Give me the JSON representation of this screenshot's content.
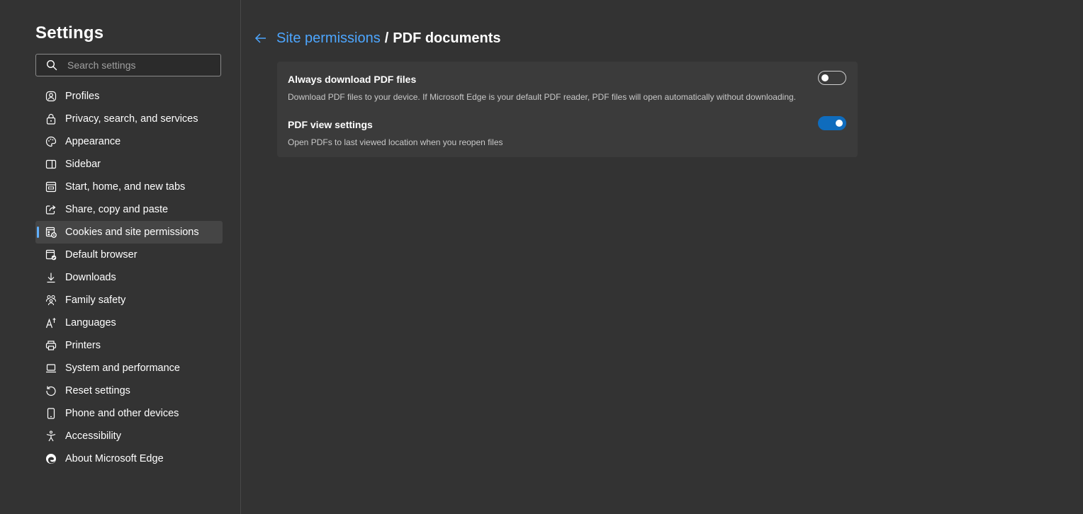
{
  "sidebar": {
    "title": "Settings",
    "search": {
      "placeholder": "Search settings",
      "value": ""
    },
    "items": [
      {
        "label": "Profiles",
        "icon": "profile-icon"
      },
      {
        "label": "Privacy, search, and services",
        "icon": "lock-icon"
      },
      {
        "label": "Appearance",
        "icon": "palette-icon"
      },
      {
        "label": "Sidebar",
        "icon": "sidebar-icon"
      },
      {
        "label": "Start, home, and new tabs",
        "icon": "home-tabs-icon"
      },
      {
        "label": "Share, copy and paste",
        "icon": "share-icon"
      },
      {
        "label": "Cookies and site permissions",
        "icon": "cookies-permissions-icon",
        "selected": true
      },
      {
        "label": "Default browser",
        "icon": "default-browser-icon"
      },
      {
        "label": "Downloads",
        "icon": "download-icon"
      },
      {
        "label": "Family safety",
        "icon": "family-icon"
      },
      {
        "label": "Languages",
        "icon": "languages-icon"
      },
      {
        "label": "Printers",
        "icon": "printer-icon"
      },
      {
        "label": "System and performance",
        "icon": "laptop-icon"
      },
      {
        "label": "Reset settings",
        "icon": "reset-icon"
      },
      {
        "label": "Phone and other devices",
        "icon": "phone-icon"
      },
      {
        "label": "Accessibility",
        "icon": "accessibility-icon"
      },
      {
        "label": "About Microsoft Edge",
        "icon": "edge-logo-icon"
      }
    ]
  },
  "header": {
    "back_icon": "back-arrow-icon",
    "parent": "Site permissions",
    "separator": "/",
    "current": "PDF documents"
  },
  "settings": [
    {
      "title": "Always download PDF files",
      "description": "Download PDF files to your device. If Microsoft Edge is your default PDF reader, PDF files will open automatically without downloading.",
      "enabled": false
    },
    {
      "title": "PDF view settings",
      "description": "Open PDFs to last viewed location when you reopen files",
      "enabled": true
    }
  ],
  "colors": {
    "background": "#333333",
    "card": "#3b3b3b",
    "accent": "#0f6cbd",
    "link": "#4da6ff"
  }
}
